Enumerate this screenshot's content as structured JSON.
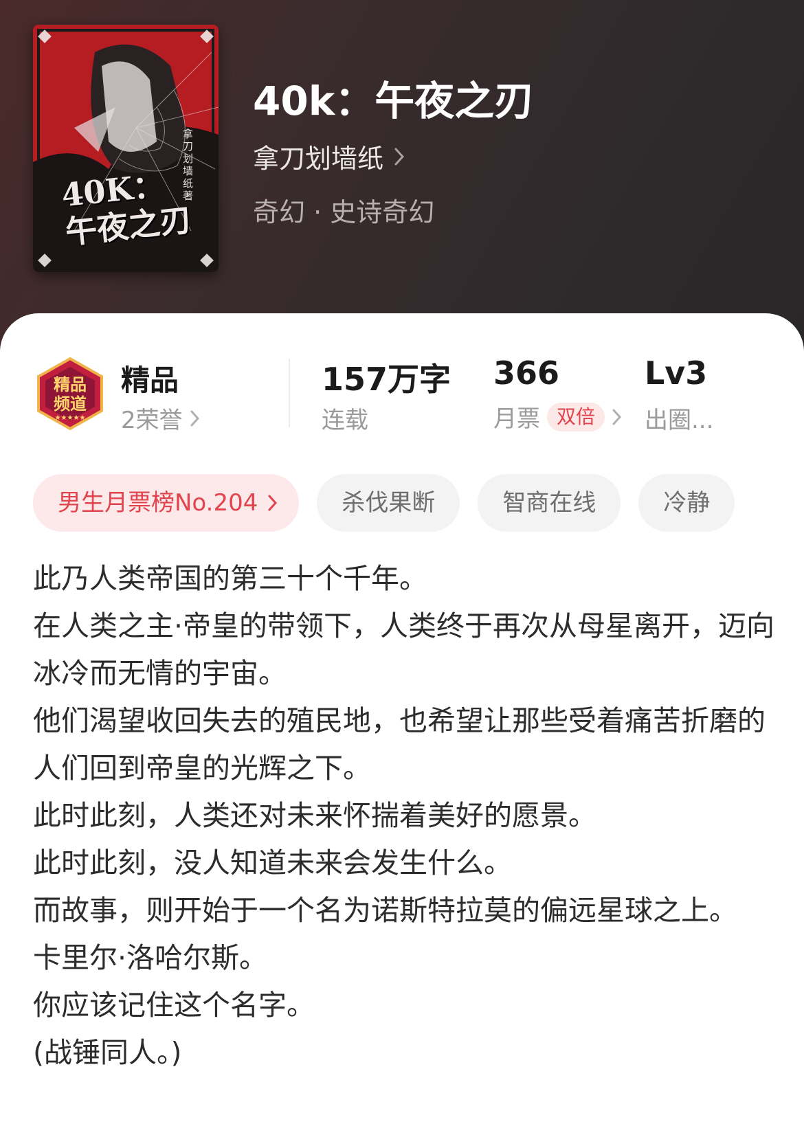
{
  "book": {
    "title": "40k：午夜之刃",
    "author": "拿刀划墙纸",
    "genre": "奇幻 · 史诗奇幻",
    "cover": {
      "title_line1": "40K：",
      "title_line2": "午夜之刃",
      "author_vertical": "拿刀划墙纸著"
    }
  },
  "stats": {
    "quality": {
      "label": "精品",
      "sub": "2荣誉",
      "badge_text": "精品频道"
    },
    "words": {
      "value": "157万字",
      "sub": "连载"
    },
    "monthly": {
      "value": "366",
      "sub": "月票",
      "tag": "双倍"
    },
    "level": {
      "value": "Lv3",
      "sub": "出圈..."
    }
  },
  "tags": [
    "男生月票榜No.204",
    "杀伐果断",
    "智商在线",
    "冷静"
  ],
  "description": [
    "此乃人类帝国的第三十个千年。",
    "在人类之主·帝皇的带领下，人类终于再次从母星离开，迈向冰冷而无情的宇宙。",
    "他们渴望收回失去的殖民地，也希望让那些受着痛苦折磨的人们回到帝皇的光辉之下。",
    "此时此刻，人类还对未来怀揣着美好的愿景。",
    "此时此刻，没人知道未来会发生什么。",
    "而故事，则开始于一个名为诺斯特拉莫的偏远星球之上。",
    "卡里尔·洛哈尔斯。",
    "你应该记住这个名字。",
    "(战锤同人。)"
  ],
  "colors": {
    "accent_red": "#e2444e",
    "tag_bg": "#f3f3f3",
    "rank_bg": "#fde9ea",
    "hero_bg": "#3a2b2c"
  }
}
